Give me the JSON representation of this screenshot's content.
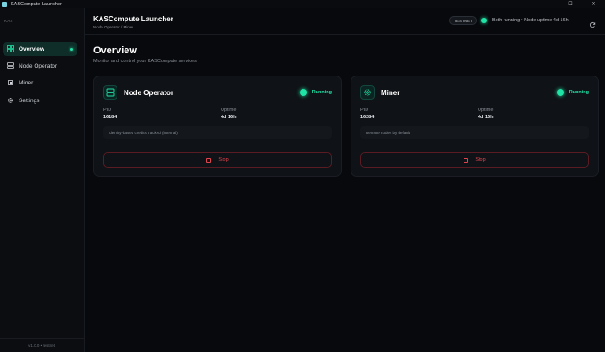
{
  "window": {
    "title": "KASCompute Launcher",
    "controls": [
      "—",
      "☐",
      "✕"
    ]
  },
  "sidebar": {
    "brand": "KAS",
    "items": [
      {
        "label": "Overview",
        "icon": "grid-icon",
        "active": true
      },
      {
        "label": "Node Operator",
        "icon": "server-icon",
        "active": false
      },
      {
        "label": "Miner",
        "icon": "chip-icon",
        "active": false
      },
      {
        "label": "Settings",
        "icon": "gear-icon",
        "active": false
      }
    ],
    "version": "v1.0.0 • testnet"
  },
  "header": {
    "title": "KASCompute Launcher",
    "breadcrumb": "Node Operator / Miner",
    "network_badge": "TESTNET",
    "status_text": "Both running • Node uptime 4d 16h"
  },
  "main": {
    "title": "Overview",
    "subtitle": "Monitor and control your KASCompute services",
    "cards": [
      {
        "title": "Node Operator",
        "icon": "server-icon",
        "status": "Running",
        "pid_label": "PID",
        "pid": "16184",
        "uptime_label": "Uptime",
        "uptime": "4d 16h",
        "note": "Identity-based credits tracked (internal)",
        "stop_label": "Stop"
      },
      {
        "title": "Miner",
        "icon": "chip-icon",
        "status": "Running",
        "pid_label": "PID",
        "pid": "16284",
        "uptime_label": "Uptime",
        "uptime": "4d 16h",
        "note": "Remote nodes by default",
        "stop_label": "Stop"
      }
    ]
  },
  "colors": {
    "accent": "#20e3a6",
    "danger": "#e0454f",
    "background": "#08090c",
    "card": "#0f1216"
  }
}
